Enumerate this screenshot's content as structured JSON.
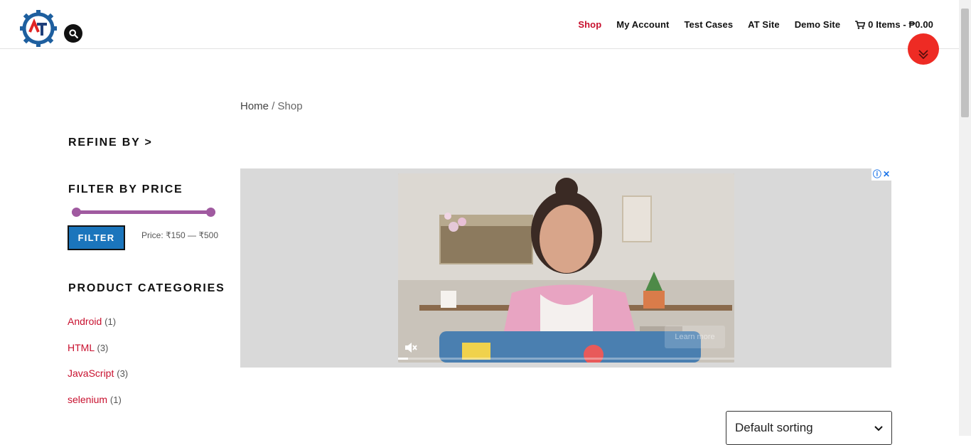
{
  "header": {
    "logo_letters": "AT",
    "nav": [
      {
        "label": "Shop",
        "active": true
      },
      {
        "label": "My Account",
        "active": false
      },
      {
        "label": "Test Cases",
        "active": false
      },
      {
        "label": "AT Site",
        "active": false
      },
      {
        "label": "Demo Site",
        "active": false
      }
    ],
    "cart": {
      "label": "0 Items - ₱0.00",
      "icon": "cart-icon"
    }
  },
  "breadcrumb": {
    "home": "Home",
    "separator": "/",
    "current": "Shop"
  },
  "sidebar": {
    "refine_heading": "REFINE BY >",
    "filter_heading": "FILTER BY PRICE",
    "filter_button": "FILTER",
    "price_range": {
      "min_handle_fraction": 0,
      "max_handle_fraction": 1
    },
    "price_label": "Price: ₹150 — ₹500",
    "categories_heading": "PRODUCT CATEGORIES",
    "categories": [
      {
        "name": "Android",
        "count": "(1)"
      },
      {
        "name": "HTML",
        "count": "(3)"
      },
      {
        "name": "JavaScript",
        "count": "(3)"
      },
      {
        "name": "selenium",
        "count": "(1)"
      }
    ]
  },
  "ad": {
    "badge_info": "ⓘ",
    "badge_close": "✕",
    "learn_more": "Learn more",
    "progress_fraction": 0.03
  },
  "sorting": {
    "selected": "Default sorting"
  },
  "colors": {
    "accent_red": "#c8102e",
    "filter_blue": "#1b75bc",
    "slider_purple": "#a05aa0",
    "fab_red": "#ee2b24"
  }
}
